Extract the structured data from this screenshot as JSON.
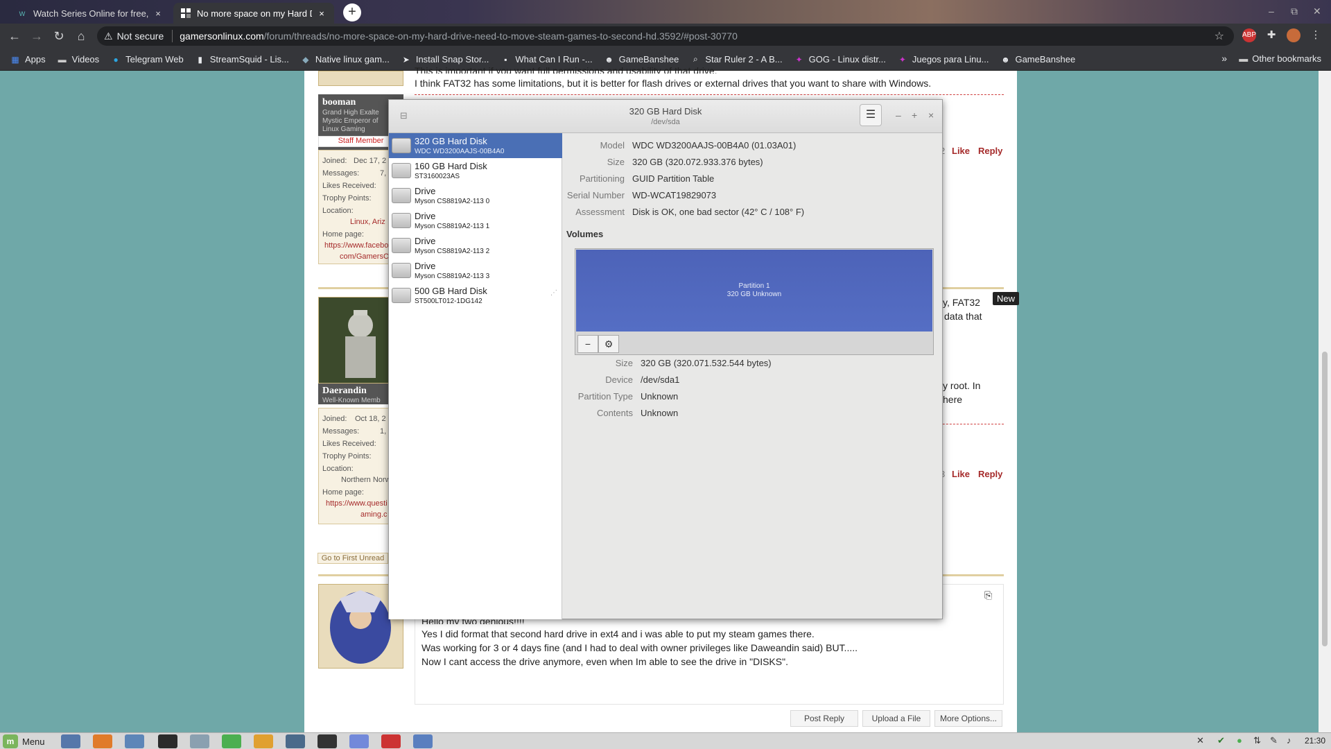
{
  "browser": {
    "tabs": [
      {
        "title": "Watch Series Online for free, f",
        "close": "×"
      },
      {
        "title": "No more space on my Hard Dri",
        "close": "×"
      }
    ],
    "new_tab": "+",
    "window_controls": {
      "minimize": "–",
      "restore": "⧉",
      "close": "✕"
    },
    "not_secure": "Not secure",
    "url_host": "gamersonlinux.com",
    "url_path": "/forum/threads/no-more-space-on-my-hard-drive-need-to-move-steam-games-to-second-hd.3592/#post-30770",
    "bookmarks": [
      "Apps",
      "Videos",
      "Telegram Web",
      "StreamSquid - Lis...",
      "Native linux gam...",
      "Install Snap Stor...",
      "What Can I Run -...",
      "GameBanshee",
      "Star Ruler 2 - A B...",
      "GOG - Linux distr...",
      "Juegos para Linu...",
      "GameBanshee"
    ],
    "bookmarks_more": "»",
    "other_bookmarks": "Other bookmarks"
  },
  "forum": {
    "post1": {
      "user": "booman",
      "title_lines": [
        "Grand High Exalte",
        "Mystic Emperor of",
        "Linux Gaming"
      ],
      "staff": "Staff Member",
      "fields": [
        "Joined:",
        "Messages:",
        "Likes Received:",
        "Trophy Points:",
        "Location:",
        "Home page:"
      ],
      "joined": "Dec 17, 2",
      "messages": "7,",
      "location": "Linux, Ariz",
      "homepage_lines": [
        "https://www.facebo",
        "com/GamersOnLi"
      ],
      "text_top": "This is important if you want full permissions and usability of that drive.",
      "text": "I think FAT32 has some limitations, but it is better for flash drives or external drives that you want to share with Windows.",
      "count_fragment": "2",
      "like": "Like",
      "reply": "Reply"
    },
    "post2": {
      "user": "Daerandin",
      "title": "Well-Known Memb",
      "fields": [
        "Joined:",
        "Messages:",
        "Likes Received:",
        "Trophy Points:",
        "Location:",
        "Home page:"
      ],
      "joined": "Oct 18, 2",
      "messages": "1,",
      "location": "Northern Norw",
      "homepage_lines": [
        "https://www.questi",
        "aming.c"
      ],
      "frag1": "y, FAT32",
      "frag2": "data that",
      "frag3": "y root. In",
      "frag4": "here",
      "count_fragment": "3",
      "like": "Like",
      "reply": "Reply"
    },
    "go_first_unread": "Go to First Unread",
    "post3_lines": [
      "Hello my two genious!!!!",
      "Yes I did format that second hard drive in ext4 and i was able to put my steam games there.",
      "Was working for 3 or 4 days fine (and I had to deal with owner privileges like Daweandin said) BUT.....",
      "Now I cant access the drive anymore, even when Im able to see the drive in \"DISKS\"."
    ],
    "footer_buttons": [
      "Post Reply",
      "Upload a File",
      "More Options..."
    ],
    "tooltip": "New"
  },
  "disks": {
    "title": "320 GB Hard Disk",
    "subtitle": "/dev/sda",
    "menu": "☰",
    "controls": {
      "minimize": "–",
      "maximize": "+",
      "close": "×"
    },
    "drives": [
      {
        "name": "320 GB Hard Disk",
        "model": "WDC WD3200AAJS-00B4A0"
      },
      {
        "name": "160 GB Hard Disk",
        "model": "ST3160023AS"
      },
      {
        "name": "Drive",
        "model": "Myson CS8819A2-113  0"
      },
      {
        "name": "Drive",
        "model": "Myson CS8819A2-113  1"
      },
      {
        "name": "Drive",
        "model": "Myson CS8819A2-113  2"
      },
      {
        "name": "Drive",
        "model": "Myson CS8819A2-113  3"
      },
      {
        "name": "500 GB Hard Disk",
        "model": "ST500LT012-1DG142"
      }
    ],
    "details": [
      {
        "label": "Model",
        "value": "WDC WD3200AAJS-00B4A0 (01.03A01)"
      },
      {
        "label": "Size",
        "value": "320 GB (320.072.933.376 bytes)"
      },
      {
        "label": "Partitioning",
        "value": "GUID Partition Table"
      },
      {
        "label": "Serial Number",
        "value": "WD-WCAT19829073"
      },
      {
        "label": "Assessment",
        "value": "Disk is OK, one bad sector (42° C / 108° F)"
      }
    ],
    "volumes_heading": "Volumes",
    "partition_name": "Partition 1",
    "partition_desc": "320 GB Unknown",
    "vol_remove": "−",
    "vol_settings": "⚙",
    "volume_details": [
      {
        "label": "Size",
        "value": "320 GB (320.071.532.544 bytes)"
      },
      {
        "label": "Device",
        "value": "/dev/sda1"
      },
      {
        "label": "Partition Type",
        "value": "Unknown"
      },
      {
        "label": "Contents",
        "value": "Unknown"
      }
    ]
  },
  "taskbar": {
    "menu": "Menu",
    "time": "21:30"
  }
}
